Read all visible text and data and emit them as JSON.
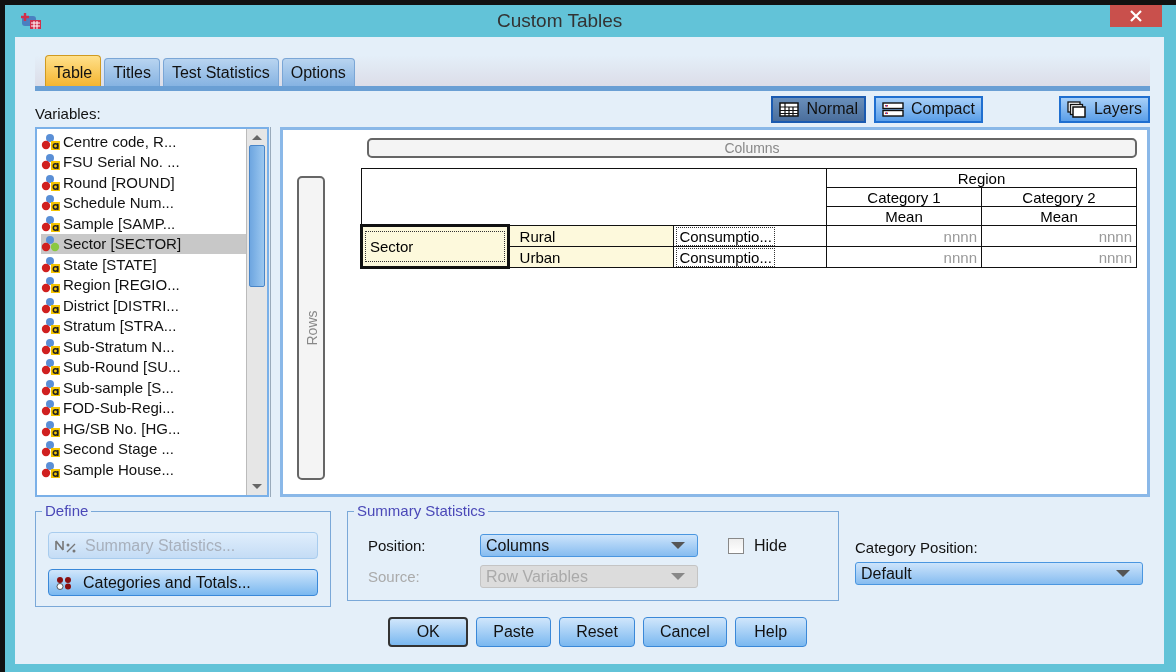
{
  "window": {
    "title": "Custom Tables"
  },
  "tabs": [
    {
      "label": "Table",
      "selected": true
    },
    {
      "label": "Titles",
      "selected": false
    },
    {
      "label": "Test Statistics",
      "selected": false
    },
    {
      "label": "Options",
      "selected": false
    }
  ],
  "variables": {
    "label": "Variables:",
    "items": [
      {
        "name": "Centre code, R...",
        "kind": "string",
        "selected": false
      },
      {
        "name": "FSU Serial No. ...",
        "kind": "string",
        "selected": false
      },
      {
        "name": "Round [ROUND]",
        "kind": "string",
        "selected": false
      },
      {
        "name": "Schedule Num...",
        "kind": "string",
        "selected": false
      },
      {
        "name": "Sample [SAMP...",
        "kind": "string",
        "selected": false
      },
      {
        "name": "Sector [SECTOR]",
        "kind": "nominal",
        "selected": true
      },
      {
        "name": "State [STATE]",
        "kind": "string",
        "selected": false
      },
      {
        "name": "Region [REGIO...",
        "kind": "string",
        "selected": false
      },
      {
        "name": "District [DISTRI...",
        "kind": "string",
        "selected": false
      },
      {
        "name": "Stratum [STRA...",
        "kind": "string",
        "selected": false
      },
      {
        "name": "Sub-Stratum N...",
        "kind": "string",
        "selected": false
      },
      {
        "name": "Sub-Round [SU...",
        "kind": "string",
        "selected": false
      },
      {
        "name": "Sub-sample [S...",
        "kind": "string",
        "selected": false
      },
      {
        "name": "FOD-Sub-Regi...",
        "kind": "string",
        "selected": false
      },
      {
        "name": "HG/SB No. [HG...",
        "kind": "string",
        "selected": false
      },
      {
        "name": "Second Stage ...",
        "kind": "string",
        "selected": false
      },
      {
        "name": "Sample House...",
        "kind": "string",
        "selected": false
      }
    ]
  },
  "view_buttons": [
    {
      "label": "Normal",
      "kind": "normal",
      "selected": true
    },
    {
      "label": "Compact",
      "kind": "compact",
      "selected": false
    }
  ],
  "layers_button": "Layers",
  "canvas": {
    "columns_label": "Columns",
    "rows_label": "Rows",
    "table": {
      "column_variable": "Region",
      "categories": [
        "Category 1",
        "Category 2"
      ],
      "statistic_headers": [
        "Mean",
        "Mean"
      ],
      "row_variable": "Sector",
      "rows": [
        {
          "category": "Rural",
          "measure": "Consumptio...",
          "values": [
            "nnnn",
            "nnnn"
          ]
        },
        {
          "category": "Urban",
          "measure": "Consumptio...",
          "values": [
            "nnnn",
            "nnnn"
          ]
        }
      ]
    }
  },
  "define": {
    "title": "Define",
    "buttons": [
      {
        "label": "Summary Statistics...",
        "kind": "summary",
        "disabled": true
      },
      {
        "label": "Categories and Totals...",
        "kind": "categories",
        "disabled": false
      }
    ]
  },
  "summary_statistics": {
    "title": "Summary Statistics",
    "position": {
      "label": "Position:",
      "value": "Columns",
      "disabled": false
    },
    "source": {
      "label": "Source:",
      "value": "Row Variables",
      "disabled": true
    },
    "hide": {
      "label": "Hide",
      "checked": false
    }
  },
  "category_position": {
    "label": "Category Position:",
    "value": "Default"
  },
  "buttons": [
    {
      "label": "OK",
      "default": true
    },
    {
      "label": "Paste",
      "default": false
    },
    {
      "label": "Reset",
      "default": false
    },
    {
      "label": "Cancel",
      "default": false
    },
    {
      "label": "Help",
      "default": false
    }
  ]
}
